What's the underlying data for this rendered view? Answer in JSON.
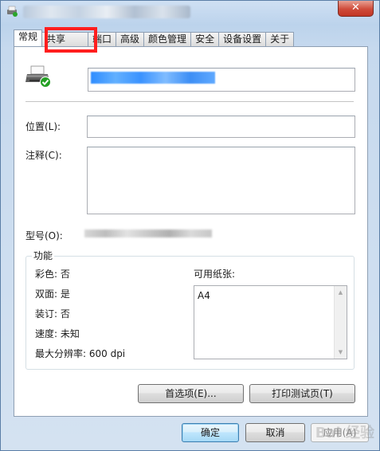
{
  "window": {
    "title": "████████████",
    "close_symbol": "✕"
  },
  "tabs": [
    {
      "label": "常规",
      "active": true
    },
    {
      "label": "共享",
      "active": false
    },
    {
      "label": "端口",
      "active": false
    },
    {
      "label": "高级",
      "active": false
    },
    {
      "label": "颜色管理",
      "active": false
    },
    {
      "label": "安全",
      "active": false
    },
    {
      "label": "设备设置",
      "active": false
    },
    {
      "label": "关于",
      "active": false
    }
  ],
  "general": {
    "printer_name": "████████████",
    "location_label": "位置(L):",
    "location_value": "",
    "comment_label": "注释(C):",
    "comment_value": "",
    "model_label": "型号(O):",
    "model_value": "██████████████",
    "features": {
      "title": "功能",
      "color": "彩色: 否",
      "duplex": "双面: 是",
      "staple": "装订: 否",
      "speed": "速度: 未知",
      "max_resolution": "最大分辨率: 600 dpi",
      "paper_label": "可用纸张:",
      "paper_items": [
        "A4"
      ]
    },
    "preferences_button": "首选项(E)...",
    "print_test_button": "打印测试页(T)"
  },
  "footer": {
    "ok": "确定",
    "cancel": "取消",
    "apply": "应用(A)"
  },
  "watermark": "Bai 经验",
  "colors": {
    "highlight": "#ff1e1e",
    "close": "#c23625",
    "selection_blue": "#3a92ff"
  }
}
